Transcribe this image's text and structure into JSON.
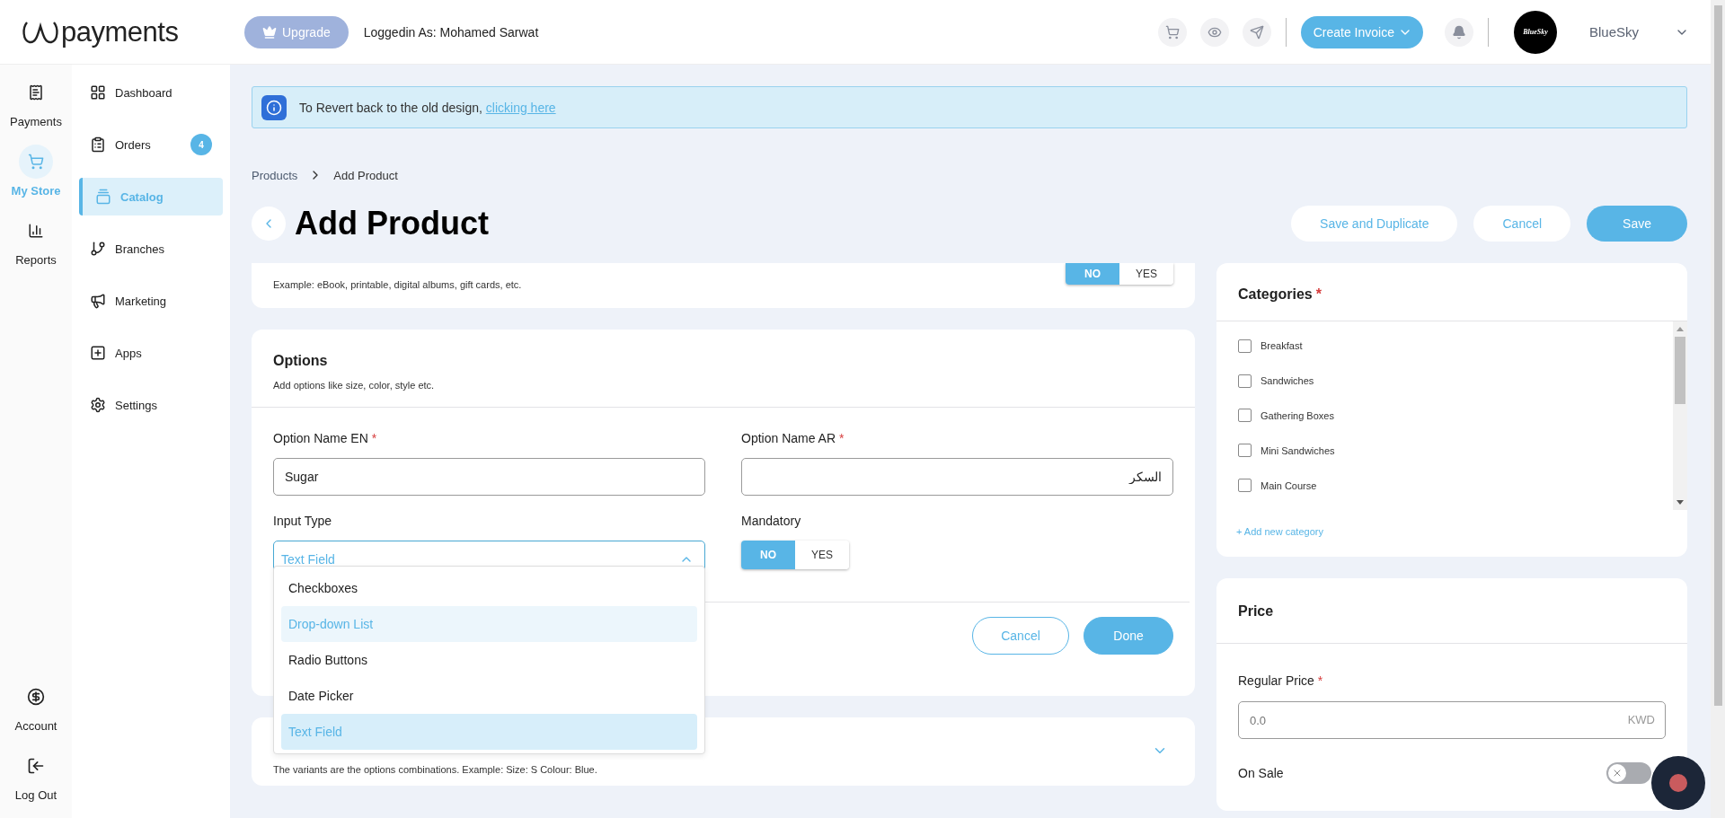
{
  "header": {
    "logo": "payments",
    "upgrade": "Upgrade",
    "logged_in": "Loggedin As: Mohamed Sarwat",
    "create_invoice": "Create Invoice",
    "avatar": "BlueSky",
    "user_name": "BlueSky"
  },
  "rail": [
    {
      "label": "Payments",
      "kind": "payments",
      "selected": false
    },
    {
      "label": "My Store",
      "kind": "store",
      "selected": true
    },
    {
      "label": "Reports",
      "kind": "reports",
      "selected": false
    }
  ],
  "rail_bottom": [
    {
      "label": "Account",
      "kind": "account"
    },
    {
      "label": "Log Out",
      "kind": "logout"
    }
  ],
  "nav": [
    {
      "label": "Dashboard",
      "kind": "dashboard",
      "selected": false
    },
    {
      "label": "Orders",
      "kind": "orders",
      "selected": false,
      "badge": "4"
    },
    {
      "label": "Catalog",
      "kind": "catalog",
      "selected": true
    },
    {
      "label": "Branches",
      "kind": "branches",
      "selected": false
    },
    {
      "label": "Marketing",
      "kind": "marketing",
      "selected": false
    },
    {
      "label": "Apps",
      "kind": "apps",
      "selected": false
    },
    {
      "label": "Settings",
      "kind": "settings",
      "selected": false
    }
  ],
  "banner": {
    "text": "To Revert back to the old design,",
    "link": "clicking here"
  },
  "breadcrumb": [
    "Products",
    "Add Product"
  ],
  "title": "Add Product",
  "actions": [
    {
      "label": "Save and Duplicate",
      "kind": "secondary"
    },
    {
      "label": "Cancel",
      "kind": "secondary"
    },
    {
      "label": "Save",
      "kind": "primary"
    }
  ],
  "digital_product": {
    "description": "Example: eBook, printable, digital albums, gift cards, etc.",
    "toggle": [
      {
        "label": "NO",
        "selected": true
      },
      {
        "label": "YES",
        "selected": false
      }
    ]
  },
  "options": {
    "title": "Options",
    "subtitle": "Add options like size, color, style etc.",
    "name_en": {
      "label": "Option Name EN",
      "required_mark": "*",
      "value": "Sugar"
    },
    "name_ar": {
      "label": "Option Name AR",
      "required_mark": "*",
      "value": "السكر"
    },
    "input_type": {
      "label": "Input Type",
      "value": "Text Field",
      "expanded": true,
      "menu": [
        {
          "label": "Checkboxes",
          "hovered": false,
          "selected": false
        },
        {
          "label": "Drop-down List",
          "hovered": true,
          "selected": false
        },
        {
          "label": "Radio Buttons",
          "hovered": false,
          "selected": false
        },
        {
          "label": "Date Picker",
          "hovered": false,
          "selected": false
        },
        {
          "label": "Text Field",
          "hovered": false,
          "selected": true
        }
      ]
    },
    "mandatory": {
      "label": "Mandatory",
      "toggle": [
        {
          "label": "NO",
          "selected": true
        },
        {
          "label": "YES",
          "selected": false
        }
      ]
    },
    "buttons": [
      {
        "label": "Cancel",
        "kind": "secondary"
      },
      {
        "label": "Done",
        "kind": "primary"
      }
    ]
  },
  "variants": {
    "description": "The variants are the options combinations. Example: Size: S Colour: Blue.",
    "expanded": false
  },
  "categories": {
    "title": "Categories",
    "required_mark": "*",
    "items": [
      {
        "label": "Breakfast",
        "checked": false
      },
      {
        "label": "Sandwiches",
        "checked": false
      },
      {
        "label": "Gathering Boxes",
        "checked": false
      },
      {
        "label": "Mini Sandwiches",
        "checked": false
      },
      {
        "label": "Main Course",
        "checked": false
      }
    ],
    "add_link": "+ Add new category"
  },
  "price": {
    "title": "Price",
    "regular_price": {
      "label": "Regular Price",
      "required_mark": "*",
      "placeholder": "0.0",
      "currency": "KWD"
    },
    "on_sale": {
      "label": "On Sale",
      "on": false
    }
  }
}
